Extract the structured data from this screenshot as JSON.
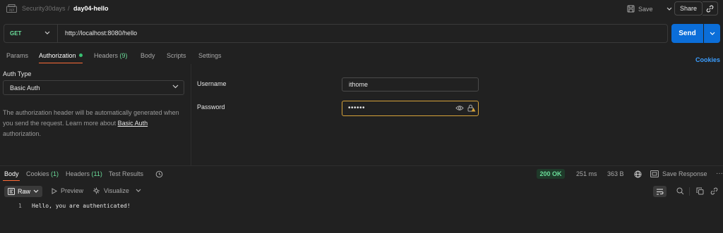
{
  "breadcrumb": {
    "parent": "Security30days",
    "separator": "/",
    "current": "day04-hello"
  },
  "header": {
    "save_label": "Save",
    "share_label": "Share"
  },
  "request": {
    "method": "GET",
    "url": "http://localhost:8080/hello",
    "send_label": "Send",
    "tabs": [
      {
        "label": "Params"
      },
      {
        "label": "Authorization"
      },
      {
        "label": "Headers",
        "count": "(9)"
      },
      {
        "label": "Body"
      },
      {
        "label": "Scripts"
      },
      {
        "label": "Settings"
      }
    ],
    "cookies_label": "Cookies"
  },
  "auth": {
    "type_label": "Auth Type",
    "type_value": "Basic Auth",
    "description": "The authorization header will be automatically generated when you send the request. Learn more about",
    "description_link": "Basic Auth",
    "description_end": "authorization.",
    "username_label": "Username",
    "username_value": "ithome",
    "password_label": "Password",
    "password_value": "••••••"
  },
  "response": {
    "tabs": [
      {
        "label": "Body"
      },
      {
        "label": "Cookies",
        "count": "(1)"
      },
      {
        "label": "Headers",
        "count": "(11)"
      },
      {
        "label": "Test Results"
      }
    ],
    "status": "200 OK",
    "time": "251 ms",
    "size": "363 B",
    "save_response_label": "Save Response",
    "more": "···",
    "view_mode": "Raw",
    "preview_label": "Preview",
    "visualize_label": "Visualize",
    "lines": [
      {
        "number": "1",
        "text": "Hello, you are authenticated!"
      }
    ]
  },
  "colors": {
    "accent": "#0b6ed9",
    "tab_underline": "#ff6c37",
    "success": "#6bdd9a",
    "focus": "#d6a23a"
  }
}
